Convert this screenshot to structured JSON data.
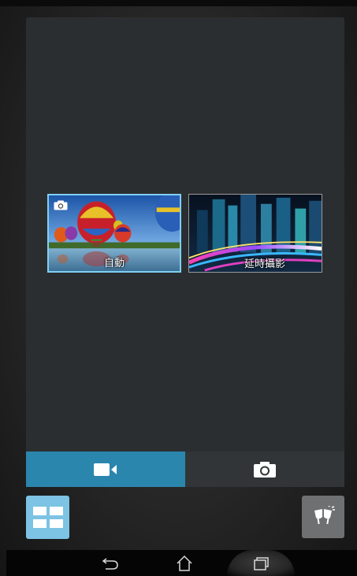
{
  "modes": [
    {
      "id": "auto",
      "label": "自動",
      "selected": true
    },
    {
      "id": "timelapse",
      "label": "延時攝影",
      "selected": false
    }
  ],
  "capture_switch": {
    "video_icon": "video-camera-icon",
    "photo_icon": "camera-icon",
    "active": "video"
  },
  "bottom_controls": {
    "mode_menu_icon": "grid-icon",
    "effect_icon": "effect-toast-icon"
  },
  "nav": {
    "back_icon": "back-icon",
    "home_icon": "home-icon",
    "recent_icon": "recent-apps-icon"
  },
  "colors": {
    "accent": "#2b86ad",
    "selected_border": "#7fd0f2",
    "menu_button": "#7dc3e3"
  }
}
